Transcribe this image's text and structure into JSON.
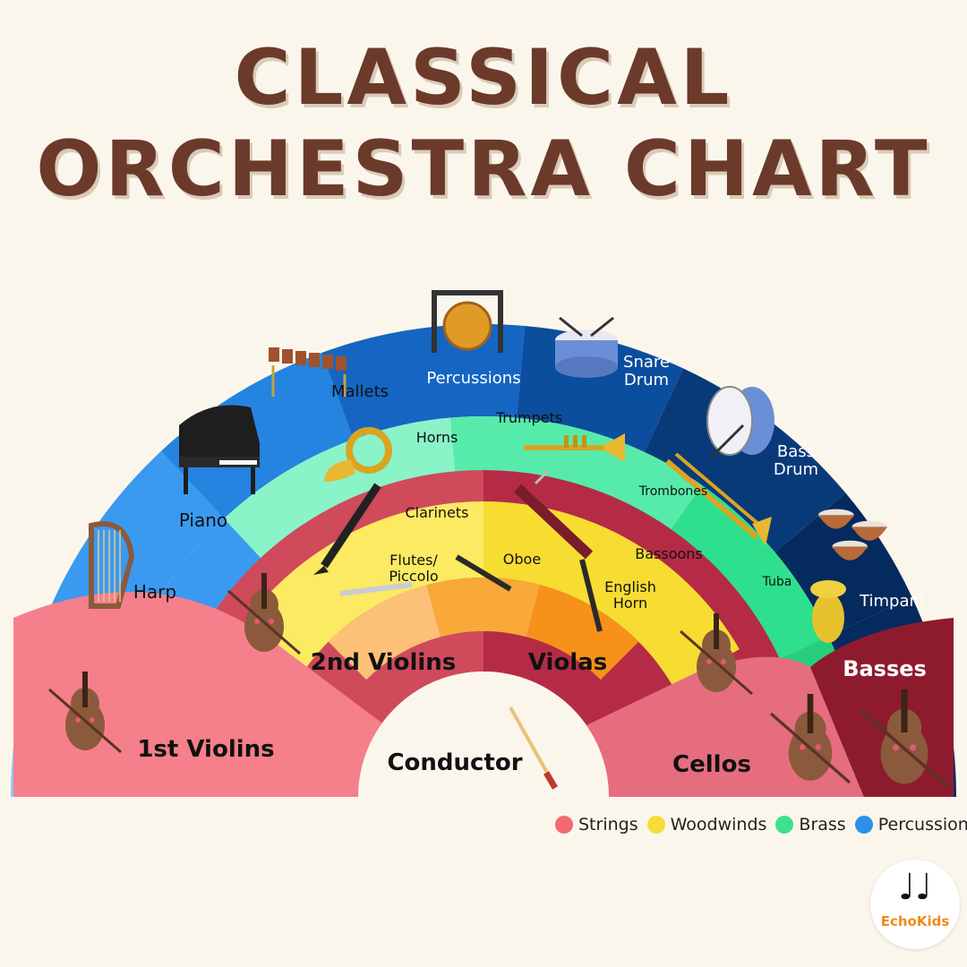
{
  "title": {
    "line1": "CLASSICAL",
    "line2": "ORCHESTRA CHART"
  },
  "conductor": "Conductor",
  "colors": {
    "strings": "#f26b72",
    "woodwinds": "#f7dd3a",
    "brass": "#3ee08f",
    "percussion": "#2d8fea"
  },
  "rings": {
    "strings": [
      {
        "label": "1st Violins",
        "color": "#f57f8b",
        "icon": "violin-icon"
      },
      {
        "label": "2nd Violins",
        "color": "#cf4a5b",
        "icon": "violin-icon"
      },
      {
        "label": "Violas",
        "color": "#b52b46",
        "icon": "viola-icon"
      },
      {
        "label": "Cellos",
        "color": "#e66d7e",
        "icon": "cello-icon"
      },
      {
        "label": "Basses",
        "color": "#8e1b2d",
        "icon": "double-bass-icon"
      }
    ],
    "woodwinds_inner": [
      {
        "label_lines": [
          "Flutes/",
          "Piccolo"
        ],
        "color": "#fcc077",
        "icon": "flute-icon"
      },
      {
        "label_lines": [
          "Oboe"
        ],
        "color": "#f9a83a",
        "icon": "oboe-icon"
      },
      {
        "label_lines": [
          "English",
          "Horn"
        ],
        "color": "#f7911a",
        "icon": "english-horn-icon"
      }
    ],
    "woodwinds_outer": [
      {
        "label": "Clarinets",
        "color": "#fbea62",
        "icon": "clarinet-icon"
      },
      {
        "label": "Bassoons",
        "color": "#f7dc32",
        "icon": "bassoon-icon"
      }
    ],
    "brass": [
      {
        "label": "Horns",
        "color": "#8af3c8",
        "icon": "french-horn-icon"
      },
      {
        "label": "Trumpets",
        "color": "#56ebaa",
        "icon": "trumpet-icon"
      },
      {
        "label": "Trombones",
        "color": "#2ee08e",
        "icon": "trombone-icon"
      },
      {
        "label": "Tuba",
        "color": "#27cf7c",
        "icon": "tuba-icon"
      }
    ],
    "percussion": [
      {
        "label": "Harp",
        "color": "#8cc7fb",
        "icon": "harp-icon"
      },
      {
        "label": "Piano",
        "color": "#3a9af0",
        "icon": "piano-icon"
      },
      {
        "label": "Mallets",
        "color": "#2484e0",
        "icon": "xylophone-icon"
      },
      {
        "label": "Percussions",
        "color": "#1466c2",
        "icon": "gong-icon"
      },
      {
        "label_lines": [
          "Snare",
          "Drum"
        ],
        "color": "#0b4e9e",
        "icon": "snare-drum-icon"
      },
      {
        "label_lines": [
          "Bass",
          "Drum"
        ],
        "color": "#083a7a",
        "icon": "bass-drum-icon"
      },
      {
        "label": "Timpani",
        "color": "#052a5e",
        "icon": "timpani-icon"
      }
    ]
  },
  "legend": [
    {
      "label": "Strings",
      "color": "#f26b72"
    },
    {
      "label": "Woodwinds",
      "color": "#f7dd3a"
    },
    {
      "label": "Brass",
      "color": "#3ee08f"
    },
    {
      "label": "Percussion",
      "color": "#2d8fea"
    }
  ],
  "logo": {
    "notes": "♩♩",
    "text": "EchoKids"
  }
}
